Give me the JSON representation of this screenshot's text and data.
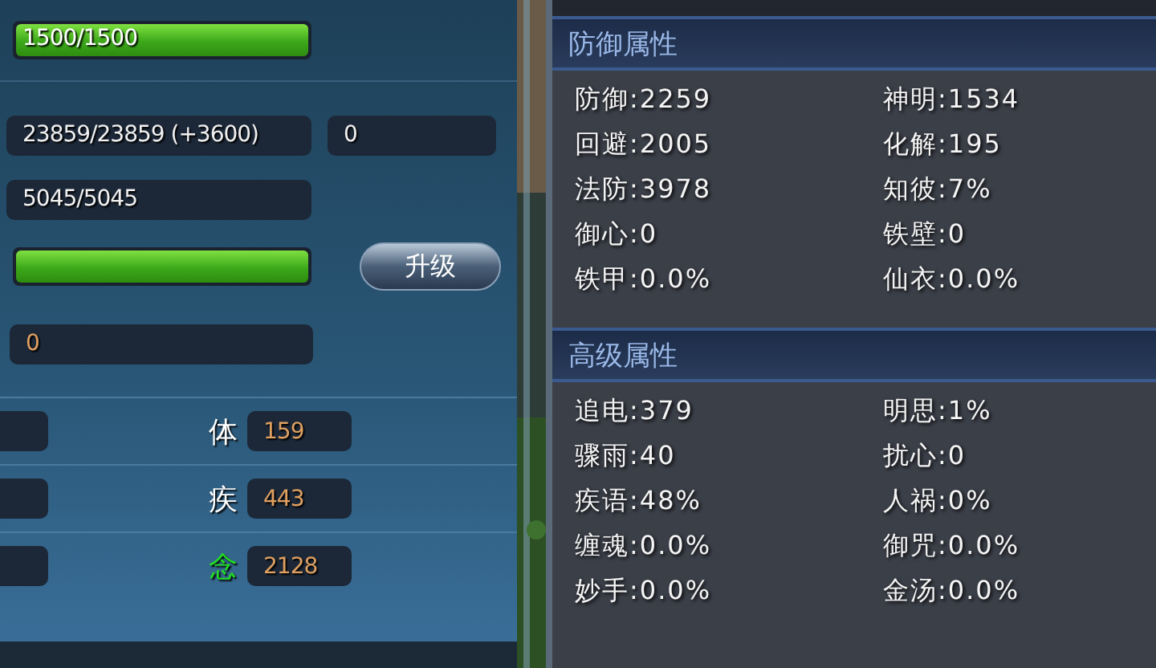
{
  "left_panel": {
    "top_bar": {
      "label": "1500/1500",
      "level": 1
    },
    "hp_field": {
      "value": "23859/23859 (+3600)"
    },
    "side_field": {
      "value": "0"
    },
    "mp_field": {
      "value": "5045/5045"
    },
    "exp_bar": {
      "level": 1
    },
    "upgrade_button": {
      "label": "升级"
    },
    "points_field": {
      "value": "0"
    },
    "stats": [
      {
        "label": "体",
        "value": "159",
        "color": "#ffffff"
      },
      {
        "label": "疾",
        "value": "443",
        "color": "#ffffff"
      },
      {
        "label": "念",
        "value": "2128",
        "color": "#22dd22"
      }
    ]
  },
  "sections": [
    {
      "title": "防御属性",
      "items": [
        {
          "text": "防御:2259"
        },
        {
          "text": "神明:1534"
        },
        {
          "text": "回避:2005"
        },
        {
          "text": "化解:195"
        },
        {
          "text": "法防:3978"
        },
        {
          "text": "知彼:7%"
        },
        {
          "text": "御心:0"
        },
        {
          "text": "铁壁:0"
        },
        {
          "text": "铁甲:0.0%"
        },
        {
          "text": "仙衣:0.0%"
        }
      ]
    },
    {
      "title": "高级属性",
      "items": [
        {
          "text": "追电:379"
        },
        {
          "text": "明思:1%"
        },
        {
          "text": "骤雨:40"
        },
        {
          "text": "扰心:0"
        },
        {
          "text": "疾语:48%"
        },
        {
          "text": "人祸:0%"
        },
        {
          "text": "缠魂:0.0%"
        },
        {
          "text": "御咒:0.0%"
        },
        {
          "text": "妙手:0.0%"
        },
        {
          "text": "金汤:0.0%"
        }
      ]
    }
  ]
}
